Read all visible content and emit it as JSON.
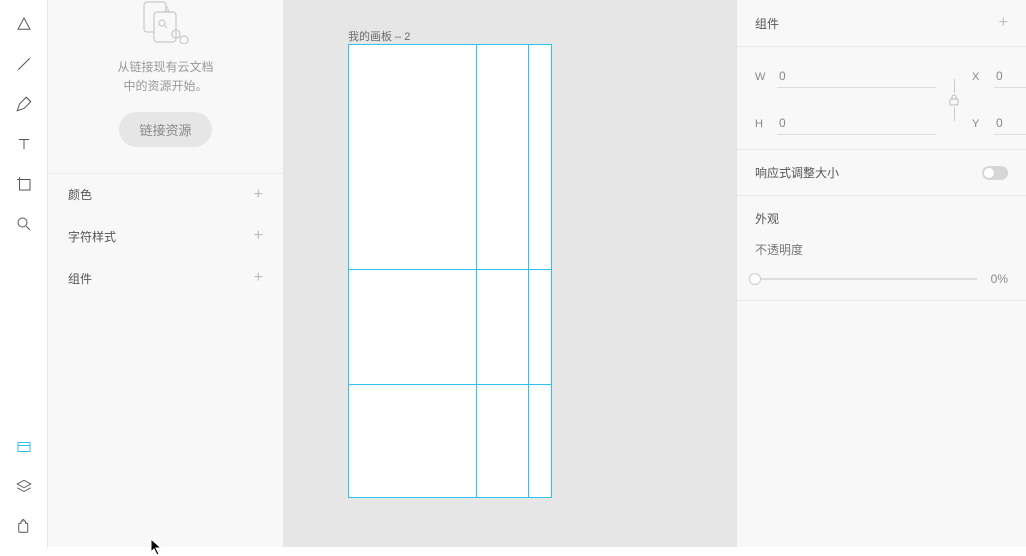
{
  "left": {
    "cloudHint1": "从链接现有云文档",
    "cloudHint2": "中的资源开始。",
    "linkButton": "链接资源",
    "sections": {
      "colors": "颜色",
      "charStyles": "字符样式",
      "components": "组件"
    }
  },
  "canvas": {
    "artboardLabel": "我的画板 – 2"
  },
  "right": {
    "componentTitle": "组件",
    "dims": {
      "wLabel": "W",
      "hLabel": "H",
      "xLabel": "X",
      "yLabel": "Y",
      "w": "0",
      "h": "0",
      "x": "0",
      "y": "0"
    },
    "responsive": "响应式调整大小",
    "appearance": "外观",
    "opacityLabel": "不透明度",
    "opacityValue": "0%"
  }
}
